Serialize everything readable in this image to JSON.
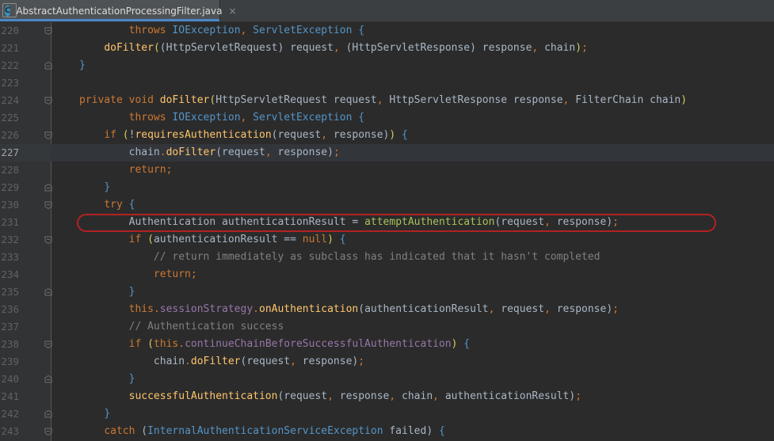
{
  "tab": {
    "icon_letter": "C",
    "title": "AbstractAuthenticationProcessingFilter.java",
    "close_glyph": "×"
  },
  "lines": [
    {
      "number": "220",
      "tokens": [
        [
          "",
          "        "
        ],
        [
          "kw",
          "throws "
        ],
        [
          "ex",
          "IOException"
        ],
        [
          "pn",
          ", "
        ],
        [
          "ex",
          "ServletException "
        ],
        [
          "br",
          "{"
        ]
      ]
    },
    {
      "number": "221",
      "tokens": [
        [
          "",
          "    "
        ],
        [
          "fn",
          "doFilter"
        ],
        [
          "yel",
          "("
        ],
        [
          "par",
          "("
        ],
        [
          "ty",
          "HttpServletRequest"
        ],
        [
          "par",
          ") "
        ],
        [
          "call",
          "request"
        ],
        [
          "pn",
          ", "
        ],
        [
          "par",
          "("
        ],
        [
          "ty",
          "HttpServletResponse"
        ],
        [
          "par",
          ") "
        ],
        [
          "call",
          "response"
        ],
        [
          "pn",
          ", "
        ],
        [
          "call",
          "chain"
        ],
        [
          "yel",
          ")"
        ],
        [
          "pn",
          ";"
        ]
      ]
    },
    {
      "number": "222",
      "tokens": [
        [
          "br",
          "}"
        ]
      ]
    },
    {
      "number": "223",
      "tokens": []
    },
    {
      "number": "224",
      "tokens": [
        [
          "kw",
          "private void "
        ],
        [
          "fn",
          "doFilter"
        ],
        [
          "yel",
          "("
        ],
        [
          "ty",
          "HttpServletRequest "
        ],
        [
          "call",
          "request"
        ],
        [
          "pn",
          ", "
        ],
        [
          "ty",
          "HttpServletResponse "
        ],
        [
          "call",
          "response"
        ],
        [
          "pn",
          ", "
        ],
        [
          "ty",
          "FilterChain "
        ],
        [
          "call",
          "chain"
        ],
        [
          "yel",
          ")"
        ]
      ]
    },
    {
      "number": "225",
      "tokens": [
        [
          "",
          "        "
        ],
        [
          "kw",
          "throws "
        ],
        [
          "ex",
          "IOException"
        ],
        [
          "pn",
          ", "
        ],
        [
          "ex",
          "ServletException "
        ],
        [
          "br",
          "{"
        ]
      ]
    },
    {
      "number": "226",
      "tokens": [
        [
          "",
          "    "
        ],
        [
          "kw",
          "if "
        ],
        [
          "yel",
          "("
        ],
        [
          "call",
          "!"
        ],
        [
          "fn",
          "requiresAuthentication"
        ],
        [
          "par",
          "("
        ],
        [
          "call",
          "request"
        ],
        [
          "pn",
          ", "
        ],
        [
          "call",
          "response"
        ],
        [
          "par",
          ")"
        ],
        [
          "yel",
          ")"
        ],
        [
          "br",
          " {"
        ]
      ]
    },
    {
      "number": "227",
      "tokens": [
        [
          "",
          "        "
        ],
        [
          "call",
          "chain"
        ],
        [
          "pn",
          "."
        ],
        [
          "fn",
          "doFilter"
        ],
        [
          "par",
          "("
        ],
        [
          "call",
          "request"
        ],
        [
          "pn",
          ", "
        ],
        [
          "call",
          "response"
        ],
        [
          "par",
          ")"
        ],
        [
          "pn",
          ";"
        ]
      ]
    },
    {
      "number": "228",
      "tokens": [
        [
          "",
          "        "
        ],
        [
          "kw",
          "return"
        ],
        [
          "pn",
          ";"
        ]
      ]
    },
    {
      "number": "229",
      "tokens": [
        [
          "",
          "    "
        ],
        [
          "br",
          "}"
        ]
      ]
    },
    {
      "number": "230",
      "tokens": [
        [
          "",
          "    "
        ],
        [
          "kw",
          "try "
        ],
        [
          "br",
          "{"
        ]
      ]
    },
    {
      "number": "231",
      "tokens": [
        [
          "",
          "        "
        ],
        [
          "ty",
          "Authentication "
        ],
        [
          "call",
          "authenticationResult "
        ],
        [
          "call",
          "= "
        ],
        [
          "gn",
          "attemptAuthentication"
        ],
        [
          "par",
          "("
        ],
        [
          "call",
          "request"
        ],
        [
          "pn",
          ", "
        ],
        [
          "call",
          "response"
        ],
        [
          "par",
          ")"
        ],
        [
          "pn",
          ";"
        ]
      ]
    },
    {
      "number": "232",
      "tokens": [
        [
          "",
          "        "
        ],
        [
          "kw",
          "if "
        ],
        [
          "yel",
          "("
        ],
        [
          "call",
          "authenticationResult == "
        ],
        [
          "kw",
          "null"
        ],
        [
          "yel",
          ")"
        ],
        [
          "br",
          " {"
        ]
      ]
    },
    {
      "number": "233",
      "tokens": [
        [
          "",
          "            "
        ],
        [
          "cm",
          "// return immediately as subclass has indicated that it hasn't completed"
        ]
      ]
    },
    {
      "number": "234",
      "tokens": [
        [
          "",
          "            "
        ],
        [
          "kw",
          "return"
        ],
        [
          "pn",
          ";"
        ]
      ]
    },
    {
      "number": "235",
      "tokens": [
        [
          "",
          "        "
        ],
        [
          "br",
          "}"
        ]
      ]
    },
    {
      "number": "236",
      "tokens": [
        [
          "",
          "        "
        ],
        [
          "kw",
          "this"
        ],
        [
          "pn",
          "."
        ],
        [
          "fld",
          "sessionStrategy"
        ],
        [
          "pn",
          "."
        ],
        [
          "fn",
          "onAuthentication"
        ],
        [
          "par",
          "("
        ],
        [
          "call",
          "authenticationResult"
        ],
        [
          "pn",
          ", "
        ],
        [
          "call",
          "request"
        ],
        [
          "pn",
          ", "
        ],
        [
          "call",
          "response"
        ],
        [
          "par",
          ")"
        ],
        [
          "pn",
          ";"
        ]
      ]
    },
    {
      "number": "237",
      "tokens": [
        [
          "",
          "        "
        ],
        [
          "cm",
          "// Authentication success"
        ]
      ]
    },
    {
      "number": "238",
      "tokens": [
        [
          "",
          "        "
        ],
        [
          "kw",
          "if "
        ],
        [
          "yel",
          "("
        ],
        [
          "kw",
          "this"
        ],
        [
          "pn",
          "."
        ],
        [
          "fld",
          "continueChainBeforeSuccessfulAuthentication"
        ],
        [
          "yel",
          ")"
        ],
        [
          "br",
          " {"
        ]
      ]
    },
    {
      "number": "239",
      "tokens": [
        [
          "",
          "            "
        ],
        [
          "call",
          "chain"
        ],
        [
          "pn",
          "."
        ],
        [
          "fn",
          "doFilter"
        ],
        [
          "par",
          "("
        ],
        [
          "call",
          "request"
        ],
        [
          "pn",
          ", "
        ],
        [
          "call",
          "response"
        ],
        [
          "par",
          ")"
        ],
        [
          "pn",
          ";"
        ]
      ]
    },
    {
      "number": "240",
      "tokens": [
        [
          "",
          "        "
        ],
        [
          "br",
          "}"
        ]
      ]
    },
    {
      "number": "241",
      "tokens": [
        [
          "",
          "        "
        ],
        [
          "fn",
          "successfulAuthentication"
        ],
        [
          "par",
          "("
        ],
        [
          "call",
          "request"
        ],
        [
          "pn",
          ", "
        ],
        [
          "call",
          "response"
        ],
        [
          "pn",
          ", "
        ],
        [
          "call",
          "chain"
        ],
        [
          "pn",
          ", "
        ],
        [
          "call",
          "authenticationResult"
        ],
        [
          "par",
          ")"
        ],
        [
          "pn",
          ";"
        ]
      ]
    },
    {
      "number": "242",
      "tokens": [
        [
          "",
          "    "
        ],
        [
          "br",
          "}"
        ]
      ]
    },
    {
      "number": "243",
      "tokens": [
        [
          "",
          "    "
        ],
        [
          "kw",
          "catch "
        ],
        [
          "par",
          "("
        ],
        [
          "ex",
          "InternalAuthenticationServiceException "
        ],
        [
          "call",
          "failed"
        ],
        [
          "par",
          ") "
        ],
        [
          "br",
          "{"
        ]
      ]
    }
  ],
  "current_line": "227",
  "highlighted_line": "231",
  "colors": {
    "background": "#2b2b2b",
    "keyword": "#cc7832",
    "method": "#ffc66d",
    "field": "#9876aa",
    "comment": "#808080",
    "highlight_oval": "#b22222"
  }
}
